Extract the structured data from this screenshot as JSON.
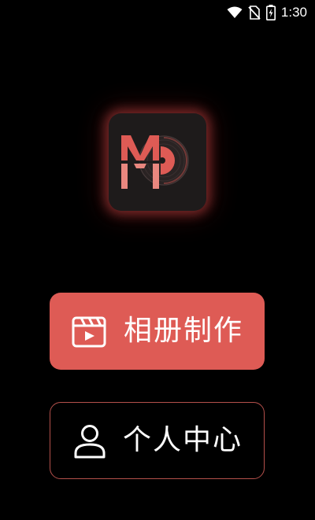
{
  "status_bar": {
    "time": "1:30",
    "icons": [
      "wifi-icon",
      "no-sim-icon",
      "battery-charging-icon"
    ]
  },
  "logo": {
    "text": "MD",
    "colors": {
      "primary": "#de5b55",
      "background": "#1e1b1b",
      "glow": "#c64646"
    }
  },
  "buttons": {
    "album": {
      "label": "相册制作",
      "icon": "video-clip-icon"
    },
    "user_center": {
      "label": "个人中心",
      "icon": "person-icon"
    }
  },
  "colors": {
    "accent": "#de5b55",
    "border": "#b4504b",
    "background": "#000000"
  }
}
